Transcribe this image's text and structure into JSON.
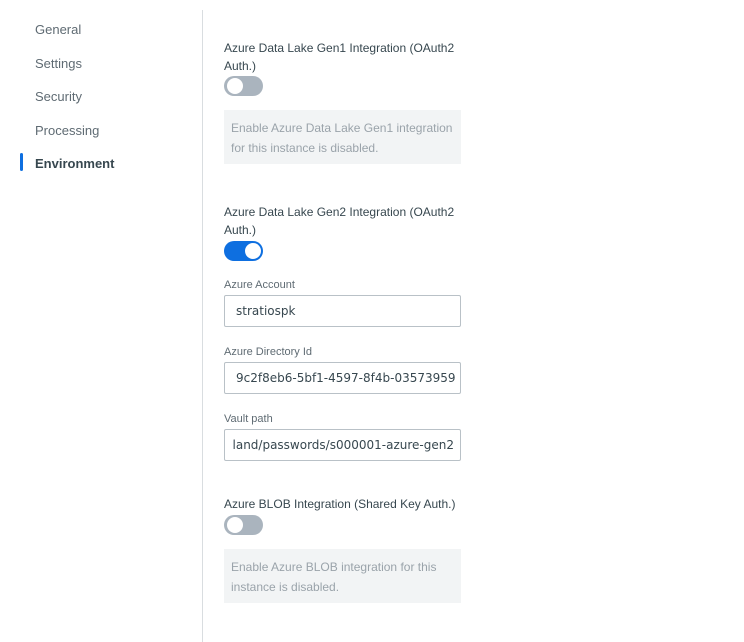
{
  "sidebar": {
    "items": [
      {
        "label": "General"
      },
      {
        "label": "Settings"
      },
      {
        "label": "Security"
      },
      {
        "label": "Processing"
      },
      {
        "label": "Environment"
      }
    ]
  },
  "gen1": {
    "title": "Azure Data Lake Gen1 Integration (OAuth2 Auth.)",
    "enabled": false,
    "info": "Enable Azure Data Lake Gen1 integration for this instance is disabled."
  },
  "gen2": {
    "title": "Azure Data Lake Gen2 Integration (OAuth2 Auth.)",
    "enabled": true,
    "account_label": "Azure Account",
    "account_value": "stratiospk",
    "directory_label": "Azure Directory Id",
    "directory_value": "9c2f8eb6-5bf1-4597-8f4b-03573959",
    "vault_label": "Vault path",
    "vault_value": "land/passwords/s000001-azure-gen2"
  },
  "blob": {
    "title": "Azure BLOB Integration (Shared Key Auth.)",
    "enabled": false,
    "info": "Enable Azure BLOB integration for this instance is disabled."
  },
  "colors": {
    "accent": "#0e6fe0",
    "toggle_off": "#aab4be",
    "info_bg": "#f2f4f5"
  }
}
